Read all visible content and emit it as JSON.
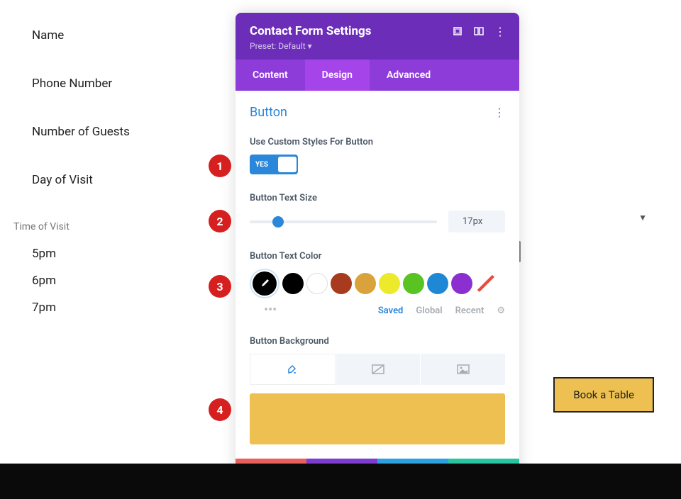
{
  "form": {
    "fields": [
      "Name",
      "Phone Number",
      "Number of Guests",
      "Day of Visit"
    ],
    "timeSection": "Time of Visit",
    "times": [
      "5pm",
      "6pm",
      "7pm"
    ]
  },
  "modal": {
    "title": "Contact Form Settings",
    "preset": "Preset: Default ▾",
    "tabs": [
      "Content",
      "Design",
      "Advanced"
    ],
    "activeTab": 1,
    "sectionTitle": "Button",
    "settings": {
      "customStyles": {
        "label": "Use Custom Styles For Button",
        "value": "YES"
      },
      "textSize": {
        "label": "Button Text Size",
        "value": "17px"
      },
      "textColor": {
        "label": "Button Text Color"
      },
      "background": {
        "label": "Button Background"
      }
    },
    "colorSwatches": [
      "#000000",
      "#000000",
      "#ffffff",
      "#b83b1e",
      "#d9a23a",
      "#ecea2b",
      "#58c322",
      "#1e88d4",
      "#8b2fd0"
    ],
    "colorTabs": [
      "Saved",
      "Global",
      "Recent"
    ],
    "activeColorTab": 0,
    "previewColor": "#edc051"
  },
  "cta": {
    "label": "Book a Table"
  },
  "annotations": [
    "1",
    "2",
    "3",
    "4"
  ]
}
